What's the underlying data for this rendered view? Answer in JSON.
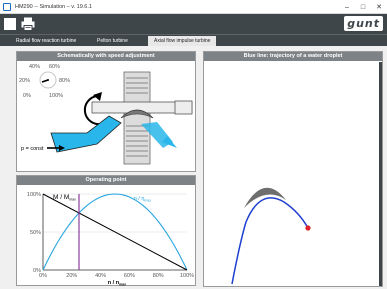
{
  "window": {
    "title": "HM290 -- Simulation – v. 19.6.1",
    "minimize": "–",
    "maximize": "□",
    "close": "✕"
  },
  "toolbar": {
    "logo": "gunt",
    "icons": [
      "stop-icon",
      "print-icon"
    ]
  },
  "tabs": [
    {
      "label": "Radial flow reaction turbine",
      "selected": false
    },
    {
      "label": "Pelton turbine",
      "selected": false
    },
    {
      "label": "Axial flow impulse turbine",
      "selected": true
    }
  ],
  "schematic": {
    "title": "Schematically with speed adjustment",
    "dial_labels": [
      "40%",
      "60%",
      "20%",
      "80%",
      "0%",
      "100%"
    ],
    "pressure_label": "p = const"
  },
  "operating": {
    "title": "Operating point",
    "y_ticks": [
      "100%",
      "50%",
      "0%"
    ],
    "x_ticks": [
      "0%",
      "20%",
      "40%",
      "60%",
      "80%",
      "100%"
    ],
    "torque_label": "M / M",
    "torque_sub": "max",
    "efficiency_label": "η / η",
    "efficiency_sub": "max",
    "x_label": "n / n",
    "x_sub": "max",
    "operating_point": 0.25,
    "colors": {
      "torque": "#000000",
      "efficiency": "#29a6e0",
      "marker": "#8a3ca0"
    }
  },
  "trajectory": {
    "title": "Blue line: trajectory of a water droplet",
    "colors": {
      "line": "#1f3fcf",
      "droplet": "#e0202a",
      "blade": "#6e6e6e"
    }
  },
  "chart_data": {
    "type": "line",
    "x": [
      0,
      20,
      40,
      60,
      80,
      100
    ],
    "series": [
      {
        "name": "M / Mmax",
        "values": [
          100,
          80,
          60,
          40,
          20,
          0
        ]
      },
      {
        "name": "η / ηmax",
        "values": [
          0,
          64,
          96,
          96,
          64,
          0
        ]
      }
    ],
    "xlabel": "n / nmax",
    "ylabel": "",
    "xlim": [
      0,
      100
    ],
    "ylim": [
      0,
      100
    ]
  }
}
